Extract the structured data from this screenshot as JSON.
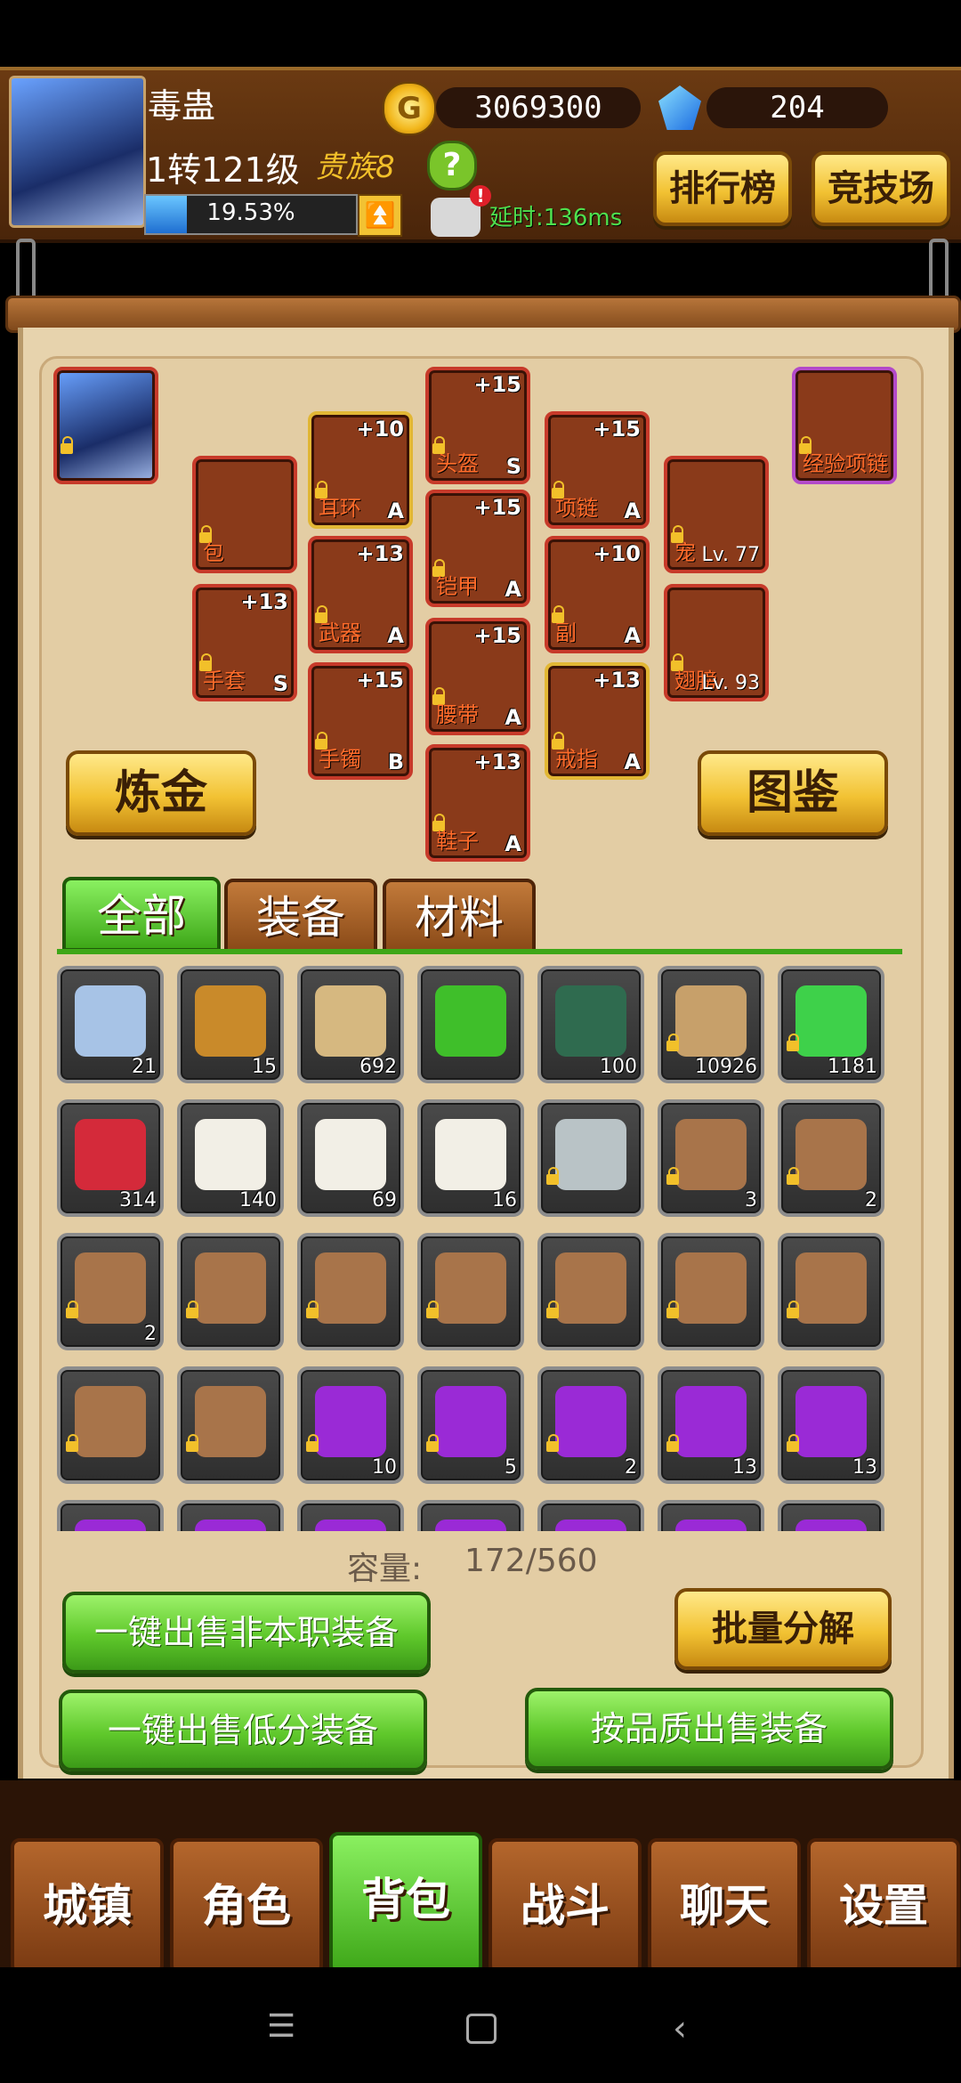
{
  "player": {
    "name": "毒蛊",
    "level_text": "1转121级",
    "clan": "贵族8",
    "exp_percent": "19.53%",
    "exp_fraction": 0.1953
  },
  "currency": {
    "gold": "3069300",
    "diamonds": "204"
  },
  "header_buttons": {
    "ranking": "排行榜",
    "arena": "竞技场"
  },
  "ping": "延时:136ms",
  "equipment": [
    {
      "label": "包",
      "plus": "",
      "grade": ""
    },
    {
      "label": "耳环",
      "plus": "+10",
      "grade": "A"
    },
    {
      "label": "头盔",
      "plus": "+15",
      "grade": "S"
    },
    {
      "label": "项链",
      "plus": "+15",
      "grade": "A"
    },
    {
      "label": "宠",
      "plus": "",
      "grade": "",
      "lv": "Lv. 77"
    },
    {
      "label": "经验项链",
      "plus": "",
      "grade": ""
    },
    {
      "label": "武器",
      "plus": "+13",
      "grade": "A"
    },
    {
      "label": "铠甲",
      "plus": "+15",
      "grade": "A"
    },
    {
      "label": "副",
      "plus": "+10",
      "grade": "A"
    },
    {
      "label": "手套",
      "plus": "+13",
      "grade": "S"
    },
    {
      "label": "手镯",
      "plus": "+15",
      "grade": "B"
    },
    {
      "label": "腰带",
      "plus": "+15",
      "grade": "A"
    },
    {
      "label": "戒指",
      "plus": "+13",
      "grade": "A"
    },
    {
      "label": "翅膀",
      "plus": "",
      "grade": "",
      "lv": "Lv. 93"
    },
    {
      "label": "鞋子",
      "plus": "+13",
      "grade": "A"
    }
  ],
  "actions": {
    "alchemy": "炼金",
    "codex": "图鉴"
  },
  "tabs": [
    "全部",
    "装备",
    "材料"
  ],
  "inventory": [
    {
      "count": "21",
      "color": "#a7c3e6",
      "locked": false
    },
    {
      "count": "15",
      "color": "#c98a2a",
      "locked": false
    },
    {
      "count": "692",
      "color": "#d6b880",
      "locked": false
    },
    {
      "count": "",
      "color": "#3fbf2a",
      "locked": false
    },
    {
      "count": "100",
      "color": "#2f6b4f",
      "locked": false
    },
    {
      "count": "10926",
      "color": "#c7a06a",
      "locked": true
    },
    {
      "count": "1181",
      "color": "#3ed14a",
      "locked": true
    },
    {
      "count": "314",
      "color": "#d42a3a",
      "locked": false
    },
    {
      "count": "140",
      "color": "#f2efe6",
      "locked": false
    },
    {
      "count": "69",
      "color": "#f2efe6",
      "locked": false
    },
    {
      "count": "16",
      "color": "#f2efe6",
      "locked": false
    },
    {
      "count": "",
      "color": "#b9c3c6",
      "locked": true
    },
    {
      "count": "3",
      "color": "#a8744a",
      "locked": true
    },
    {
      "count": "2",
      "color": "#a8744a",
      "locked": true
    },
    {
      "count": "2",
      "color": "#a8744a",
      "locked": true
    },
    {
      "count": "",
      "color": "#a8744a",
      "locked": true
    },
    {
      "count": "",
      "color": "#a8744a",
      "locked": true
    },
    {
      "count": "",
      "color": "#a8744a",
      "locked": true
    },
    {
      "count": "",
      "color": "#a8744a",
      "locked": true
    },
    {
      "count": "",
      "color": "#a8744a",
      "locked": true
    },
    {
      "count": "",
      "color": "#a8744a",
      "locked": true
    },
    {
      "count": "",
      "color": "#a8744a",
      "locked": true
    },
    {
      "count": "",
      "color": "#a8744a",
      "locked": true
    },
    {
      "count": "10",
      "color": "#9a2ad6",
      "locked": true
    },
    {
      "count": "5",
      "color": "#9a2ad6",
      "locked": true
    },
    {
      "count": "2",
      "color": "#9a2ad6",
      "locked": true
    },
    {
      "count": "13",
      "color": "#9a2ad6",
      "locked": true
    },
    {
      "count": "13",
      "color": "#9a2ad6",
      "locked": true
    },
    {
      "count": "",
      "color": "#9a2ad6",
      "locked": false
    },
    {
      "count": "",
      "color": "#9a2ad6",
      "locked": false
    },
    {
      "count": "",
      "color": "#9a2ad6",
      "locked": false
    },
    {
      "count": "",
      "color": "#9a2ad6",
      "locked": false
    },
    {
      "count": "",
      "color": "#9a2ad6",
      "locked": false
    },
    {
      "count": "",
      "color": "#9a2ad6",
      "locked": false
    },
    {
      "count": "",
      "color": "#9a2ad6",
      "locked": false
    }
  ],
  "capacity": {
    "label": "容量:",
    "value": "172/560"
  },
  "buttons": {
    "sell_non_class": "一键出售非本职装备",
    "batch_decompose": "批量分解",
    "sell_low_score": "一键出售低分装备",
    "sell_by_quality": "按品质出售装备"
  },
  "nav": [
    "城镇",
    "角色",
    "背包",
    "战斗",
    "聊天",
    "设置"
  ],
  "active_nav": 2
}
